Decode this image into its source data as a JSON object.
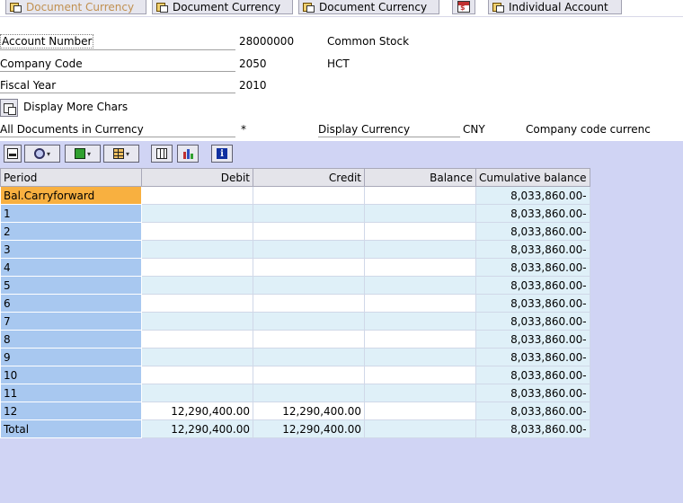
{
  "toolbar": {
    "buttons": [
      {
        "label": "Document Currency",
        "enabled": false
      },
      {
        "label": "Document Currency",
        "enabled": true
      },
      {
        "label": "Document Currency",
        "enabled": true
      },
      {
        "label": "Individual Account",
        "enabled": true
      }
    ]
  },
  "header": {
    "account_number_label": "Account Number",
    "account_number_value": "28000000",
    "account_name": "Common Stock",
    "company_code_label": "Company Code",
    "company_code_value": "2050",
    "company_code_name": "HCT",
    "fiscal_year_label": "Fiscal Year",
    "fiscal_year_value": "2010",
    "more_chars_label": "Display More Chars",
    "all_docs_label": "All Documents in Currency",
    "all_docs_value": "*",
    "display_currency_label": "Display Currency",
    "display_currency_value": "CNY",
    "currency_note": "Company code currenc"
  },
  "grid": {
    "columns": [
      "Period",
      "Debit",
      "Credit",
      "Balance",
      "Cumulative balance"
    ],
    "rows": [
      {
        "period": "Bal.Carryforward",
        "debit": "",
        "credit": "",
        "balance": "",
        "cumulative": "8,033,860.00-"
      },
      {
        "period": "1",
        "debit": "",
        "credit": "",
        "balance": "",
        "cumulative": "8,033,860.00-"
      },
      {
        "period": "2",
        "debit": "",
        "credit": "",
        "balance": "",
        "cumulative": "8,033,860.00-"
      },
      {
        "period": "3",
        "debit": "",
        "credit": "",
        "balance": "",
        "cumulative": "8,033,860.00-"
      },
      {
        "period": "4",
        "debit": "",
        "credit": "",
        "balance": "",
        "cumulative": "8,033,860.00-"
      },
      {
        "period": "5",
        "debit": "",
        "credit": "",
        "balance": "",
        "cumulative": "8,033,860.00-"
      },
      {
        "period": "6",
        "debit": "",
        "credit": "",
        "balance": "",
        "cumulative": "8,033,860.00-"
      },
      {
        "period": "7",
        "debit": "",
        "credit": "",
        "balance": "",
        "cumulative": "8,033,860.00-"
      },
      {
        "period": "8",
        "debit": "",
        "credit": "",
        "balance": "",
        "cumulative": "8,033,860.00-"
      },
      {
        "period": "9",
        "debit": "",
        "credit": "",
        "balance": "",
        "cumulative": "8,033,860.00-"
      },
      {
        "period": "10",
        "debit": "",
        "credit": "",
        "balance": "",
        "cumulative": "8,033,860.00-"
      },
      {
        "period": "11",
        "debit": "",
        "credit": "",
        "balance": "",
        "cumulative": "8,033,860.00-"
      },
      {
        "period": "12",
        "debit": "12,290,400.00",
        "credit": "12,290,400.00",
        "balance": "",
        "cumulative": "8,033,860.00-"
      },
      {
        "period": "Total",
        "debit": "12,290,400.00",
        "credit": "12,290,400.00",
        "balance": "",
        "cumulative": "8,033,860.00-"
      }
    ]
  },
  "colors": {
    "lower_background": "#d0d4f4",
    "period_column": "#a8c8f0",
    "selected_row": "#f8b040",
    "alt_row": "#dff0f8",
    "disabled_text": "#c09050"
  }
}
